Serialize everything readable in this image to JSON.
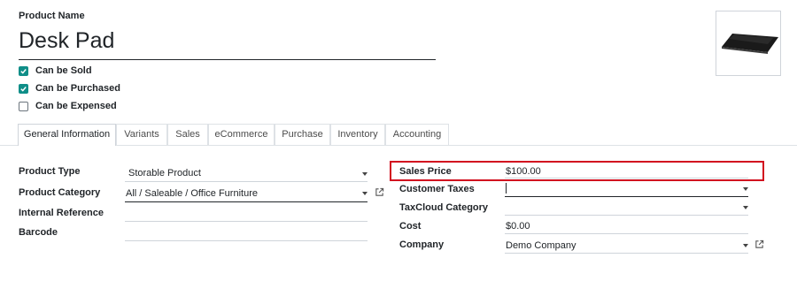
{
  "product": {
    "name_label": "Product Name",
    "name": "Desk Pad"
  },
  "options": [
    {
      "label": "Can be Sold",
      "checked": true
    },
    {
      "label": "Can be Purchased",
      "checked": true
    },
    {
      "label": "Can be Expensed",
      "checked": false
    }
  ],
  "tabs": [
    {
      "label": "General Information",
      "active": true
    },
    {
      "label": "Variants"
    },
    {
      "label": "Sales"
    },
    {
      "label": "eCommerce"
    },
    {
      "label": "Purchase"
    },
    {
      "label": "Inventory"
    },
    {
      "label": "Accounting"
    }
  ],
  "left_fields": [
    {
      "label": "Product Type",
      "value": "Storable Product"
    },
    {
      "label": "Product Category",
      "value": "All / Saleable / Office Furniture"
    },
    {
      "label": "Internal Reference",
      "value": ""
    },
    {
      "label": "Barcode",
      "value": ""
    }
  ],
  "right_fields": [
    {
      "label": "Sales Price",
      "value": "$100.00"
    },
    {
      "label": "Customer Taxes",
      "value": ""
    },
    {
      "label": "TaxCloud Category",
      "value": ""
    },
    {
      "label": "Cost",
      "value": "$0.00"
    },
    {
      "label": "Company",
      "value": "Demo Company"
    }
  ],
  "colors": {
    "check": "#0f8e88",
    "highlight": "#d20f1f"
  }
}
